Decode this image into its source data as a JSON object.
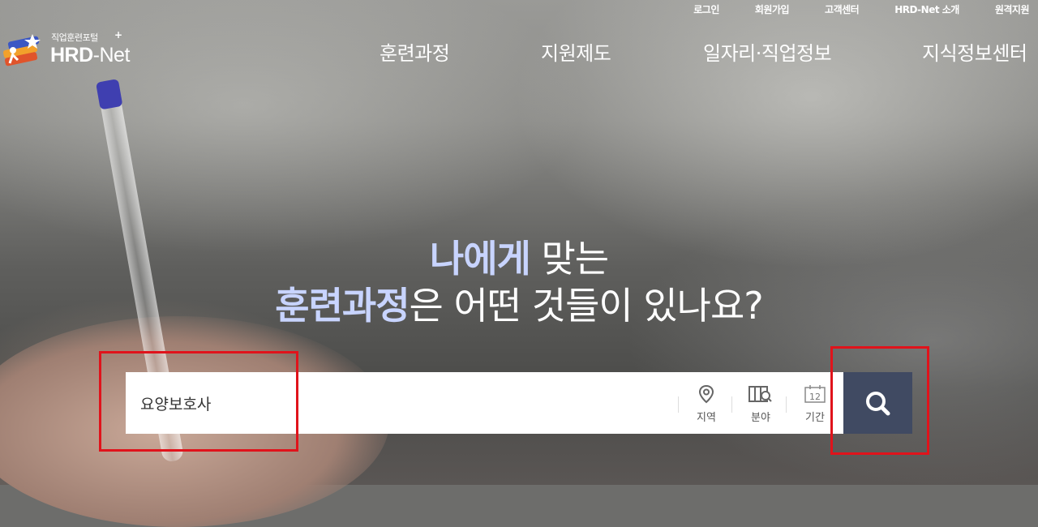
{
  "utility_links": [
    "로그인",
    "회원가입",
    "고객센터",
    "HRD-Net 소개",
    "원격지원"
  ],
  "logo": {
    "subtitle": "직업훈련포털",
    "title_bold": "HRD",
    "title_rest": "-Net"
  },
  "nav": [
    "훈련과정",
    "지원제도",
    "일자리·직업정보",
    "지식정보센터"
  ],
  "headline": {
    "line1_accent": "나에게",
    "line1_rest": " 맞는",
    "line2_accent": "훈련과정",
    "line2_rest": "은 어떤 것들이 있나요?"
  },
  "search": {
    "value": "요양보호사",
    "filters": [
      {
        "label": "지역",
        "icon": "location-pin-icon"
      },
      {
        "label": "분야",
        "icon": "field-search-icon"
      },
      {
        "label": "기간",
        "icon": "calendar-icon",
        "calendar_number": "12"
      }
    ],
    "button_icon": "search-icon"
  },
  "colors": {
    "accent_text": "#c8d4ff",
    "search_button": "#404a62",
    "highlight": "#e0131b"
  }
}
